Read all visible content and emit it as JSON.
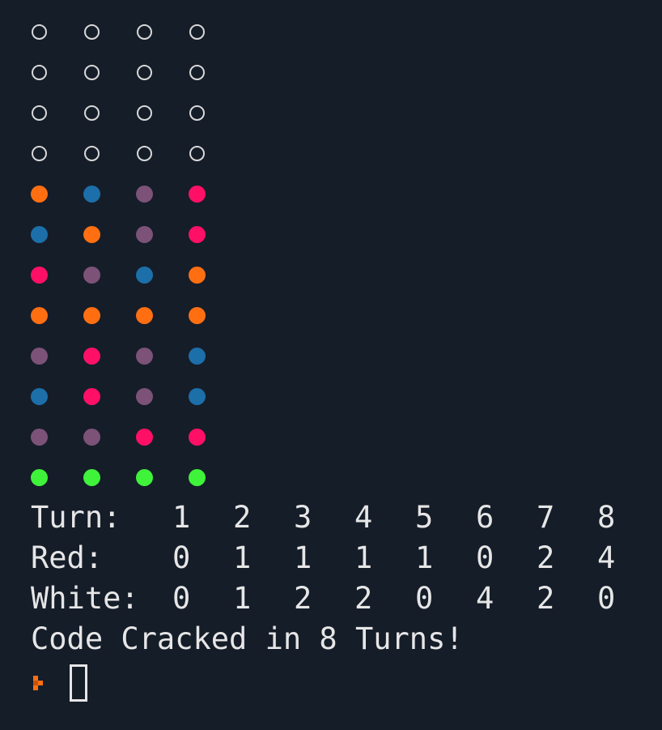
{
  "colors": {
    "background": "#151d29",
    "text": "#e6e6e6",
    "orange": "#ff6f12",
    "blue": "#1c6fa8",
    "purple": "#7c5278",
    "pink": "#ff1066",
    "green": "#3ff23a",
    "empty": "#d8d8d8"
  },
  "board": [
    [
      "empty",
      "empty",
      "empty",
      "empty"
    ],
    [
      "empty",
      "empty",
      "empty",
      "empty"
    ],
    [
      "empty",
      "empty",
      "empty",
      "empty"
    ],
    [
      "empty",
      "empty",
      "empty",
      "empty"
    ],
    [
      "orange",
      "blue",
      "purple",
      "pink"
    ],
    [
      "blue",
      "orange",
      "purple",
      "pink"
    ],
    [
      "pink",
      "purple",
      "blue",
      "orange"
    ],
    [
      "orange",
      "orange",
      "orange",
      "orange"
    ],
    [
      "purple",
      "pink",
      "purple",
      "blue"
    ],
    [
      "blue",
      "pink",
      "purple",
      "blue"
    ],
    [
      "purple",
      "purple",
      "pink",
      "pink"
    ],
    [
      "green",
      "green",
      "green",
      "green"
    ]
  ],
  "stats": {
    "turn": {
      "label": "Turn:",
      "values": [
        "1",
        "2",
        "3",
        "4",
        "5",
        "6",
        "7",
        "8"
      ]
    },
    "red": {
      "label": "Red:",
      "values": [
        "0",
        "1",
        "1",
        "1",
        "1",
        "0",
        "2",
        "4"
      ]
    },
    "white": {
      "label": "White:",
      "values": [
        "0",
        "1",
        "2",
        "2",
        "0",
        "4",
        "2",
        "0"
      ]
    }
  },
  "message": "Code Cracked in 8 Turns!",
  "prompt": {
    "icon": "prompt-arrow-icon",
    "cursor": "block-cursor"
  }
}
